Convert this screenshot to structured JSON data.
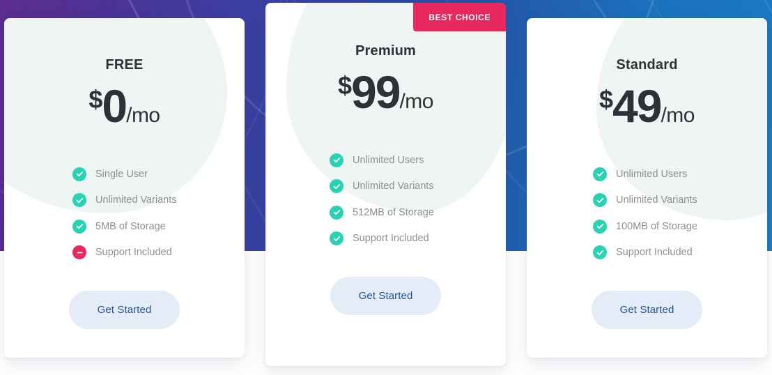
{
  "theme": {
    "gradient_start": "#5b2d8e",
    "gradient_mid": "#34469f",
    "gradient_end": "#1a7cc4",
    "card_bg": "#ffffff",
    "blob_color": "#eff5f3",
    "badge_bg": "#e8285f",
    "check_color": "#2ad2b4",
    "excluded_color": "#e8285f",
    "feature_text": "#8b8f96",
    "heading_text": "#2e3138",
    "cta_bg": "#e4edf7",
    "cta_text": "#20509e"
  },
  "plans": [
    {
      "id": "free",
      "name": "FREE",
      "currency": "$",
      "amount": "0",
      "period": "/mo",
      "featured": false,
      "badge": null,
      "features": [
        {
          "label": "Single User",
          "included": true,
          "icon": "check-icon"
        },
        {
          "label": "Unlimited Variants",
          "included": true,
          "icon": "check-icon"
        },
        {
          "label": "5MB of Storage",
          "included": true,
          "icon": "check-icon"
        },
        {
          "label": "Support Included",
          "included": false,
          "icon": "minus-icon"
        }
      ],
      "cta": "Get Started"
    },
    {
      "id": "premium",
      "name": "Premium",
      "currency": "$",
      "amount": "99",
      "period": "/mo",
      "featured": true,
      "badge": "BEST CHOICE",
      "features": [
        {
          "label": "Unlimited Users",
          "included": true,
          "icon": "check-icon"
        },
        {
          "label": "Unlimited Variants",
          "included": true,
          "icon": "check-icon"
        },
        {
          "label": "512MB of Storage",
          "included": true,
          "icon": "check-icon"
        },
        {
          "label": "Support Included",
          "included": true,
          "icon": "check-icon"
        }
      ],
      "cta": "Get Started"
    },
    {
      "id": "standard",
      "name": "Standard",
      "currency": "$",
      "amount": "49",
      "period": "/mo",
      "featured": false,
      "badge": null,
      "features": [
        {
          "label": "Unlimited Users",
          "included": true,
          "icon": "check-icon"
        },
        {
          "label": "Unlimited Variants",
          "included": true,
          "icon": "check-icon"
        },
        {
          "label": "100MB of Storage",
          "included": true,
          "icon": "check-icon"
        },
        {
          "label": "Support Included",
          "included": true,
          "icon": "check-icon"
        }
      ],
      "cta": "Get Started"
    }
  ]
}
